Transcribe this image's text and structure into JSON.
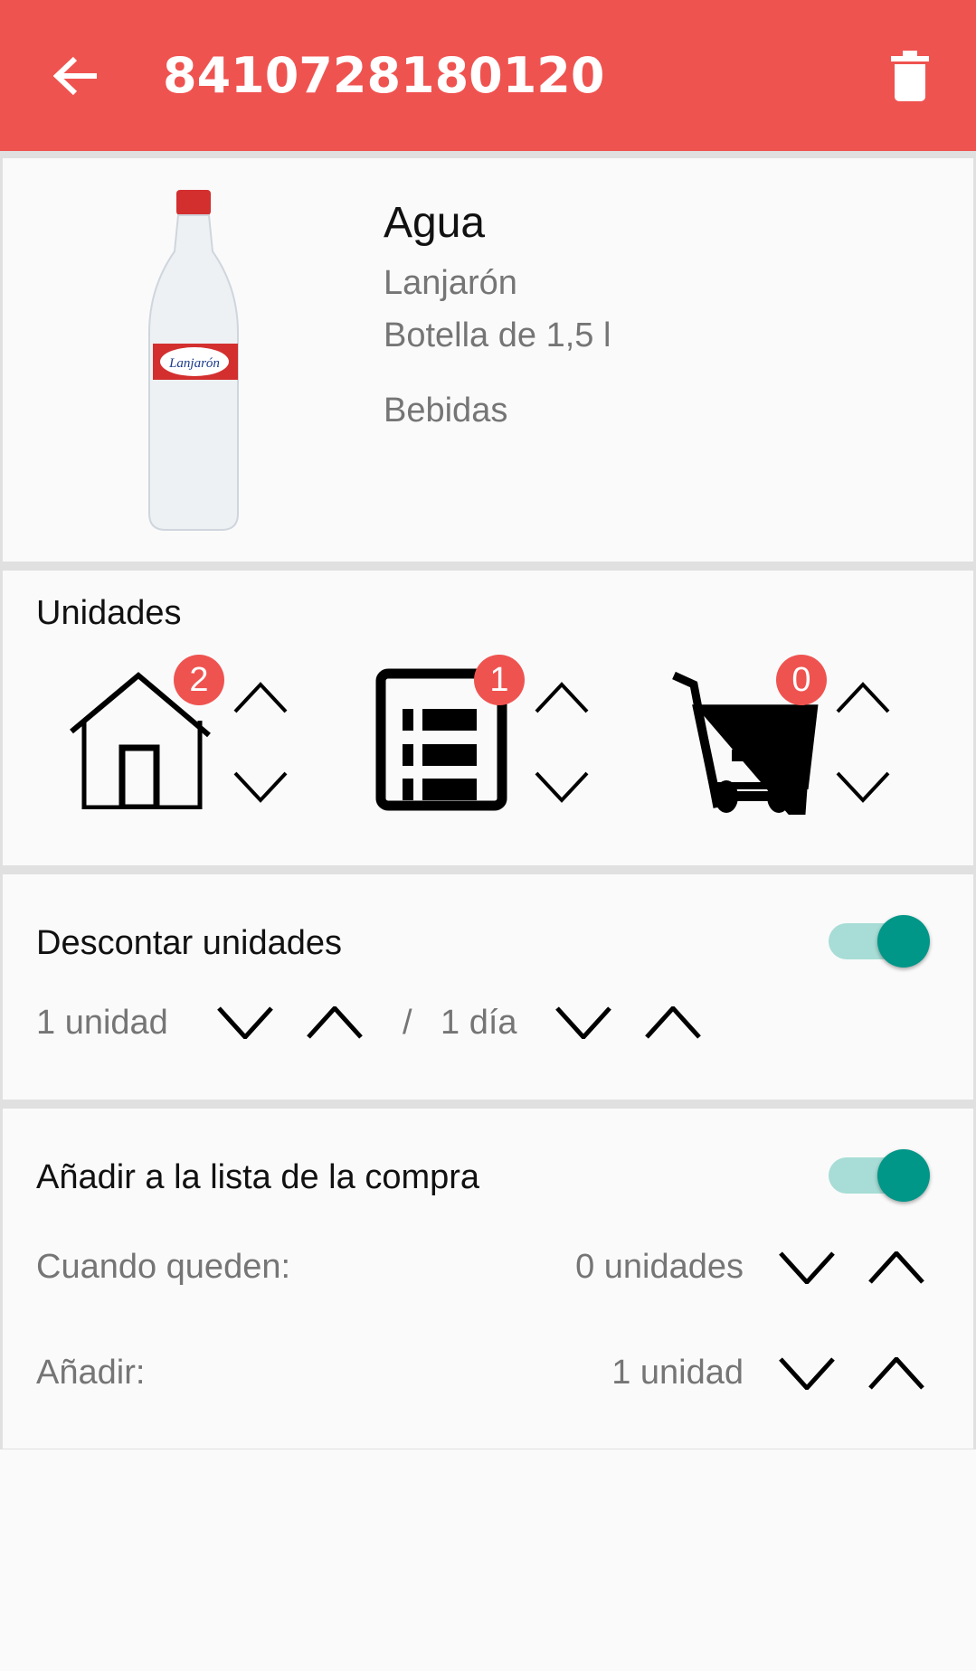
{
  "header": {
    "title": "8410728180120",
    "back_icon": "arrow-left-icon",
    "delete_icon": "trash-icon",
    "color": "#ef5350"
  },
  "product": {
    "name": "Agua",
    "brand": "Lanjarón",
    "format": "Botella de 1,5 l",
    "category": "Bebidas",
    "image_label": "Lanjarón"
  },
  "units": {
    "title": "Unidades",
    "home_count": "2",
    "list_count": "1",
    "cart_count": "0"
  },
  "discount": {
    "title": "Descontar unidades",
    "enabled": true,
    "amount": "1 unidad",
    "separator": "/",
    "period": "1 día"
  },
  "shopping": {
    "title": "Añadir a la lista de la compra",
    "enabled": true,
    "when_label": "Cuando queden:",
    "when_value": "0 unidades",
    "add_label": "Añadir:",
    "add_value": "1 unidad"
  },
  "accent": "#009688"
}
